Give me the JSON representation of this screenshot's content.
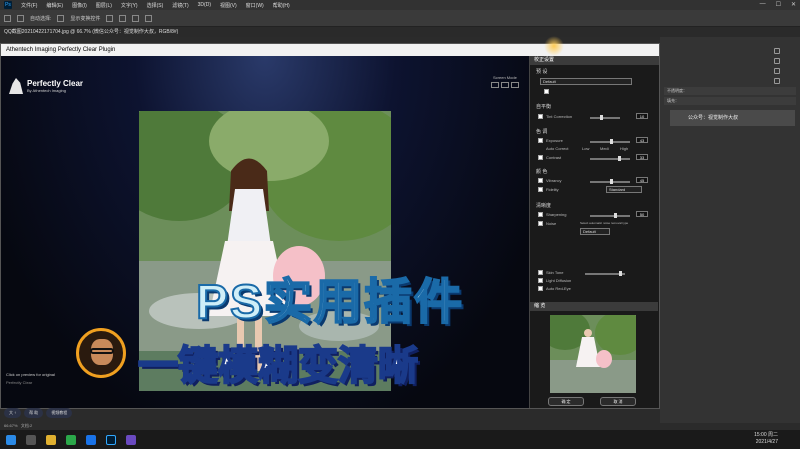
{
  "menubar": {
    "app_icon": "Ps",
    "items": [
      "文件(F)",
      "编辑(E)",
      "图像(I)",
      "图层(L)",
      "文字(Y)",
      "选择(S)",
      "滤镜(T)",
      "3D(D)",
      "视图(V)",
      "窗口(W)",
      "帮助(H)"
    ]
  },
  "optionsbar": {
    "auto_select": "自动选择:",
    "transform": "显示变换控件"
  },
  "tabbar": {
    "doc_tab": "QQ截图20210422171704.jpg @ 66.7% (微信公众号：视觉制作大叔，RGB/8#)"
  },
  "right_panel": {
    "rows": [
      "不透明度：",
      "填充："
    ],
    "layer_name": "公众号：视觉制作大叔"
  },
  "ps_status": {
    "zoom": "66.67%",
    "doc": "文档:2"
  },
  "plugin": {
    "title": "Athentech Imaging Perfectly Clear Plugin",
    "logo_name": "Perfectly Clear",
    "logo_sub": "By Athentech Imaging",
    "screen_mode": "Screen Mode",
    "preview_hint": "Click on preview for original",
    "preview_hint2": "Perfectly Clear",
    "bottom_tabs": [
      "大 ↑",
      "帮 助",
      "视频教程"
    ],
    "settings_header": "校正设置",
    "preset_label": "预 设",
    "preset_value": "Default",
    "sections": {
      "auto": "自平衡",
      "color": "色 调",
      "vivid": "颜 色",
      "sharp": "清晰度"
    },
    "controls": {
      "tint_correction": "Tint Correction",
      "tint_val": "10",
      "exposure": "Exposure",
      "exposure_val": "43",
      "auto_correct": "Auto Correct",
      "low": "Low",
      "medium": "Medi",
      "high": "High",
      "contrast": "Contrast",
      "contrast_val": "33",
      "vibrancy": "Vibrancy",
      "vibrancy_val": "45",
      "fidelity": "Fidelity",
      "fidelity_val": "Standard",
      "sharpening": "Sharpening",
      "sharpening_val": "50",
      "noise": "Noise",
      "noise_hint": "Select automatic noise removal type",
      "noise_val": "Default",
      "skin_tone": "Skin Tone",
      "light_diffusion": "Light Diffusion",
      "auto_redeye": "Auto Red-Eye"
    },
    "thumb_header": "缩 览",
    "ok": "确 定",
    "cancel": "取 消"
  },
  "overlay": {
    "caption1": "PS实用插件",
    "caption2": "一键模糊变清晰"
  },
  "taskbar": {
    "time": "15:00 周二",
    "date": "2021/4/27"
  },
  "colors": {
    "accent": "#31a8ff",
    "caption_fill": "#cfeef8",
    "caption_stroke": "#1a6aa8"
  }
}
